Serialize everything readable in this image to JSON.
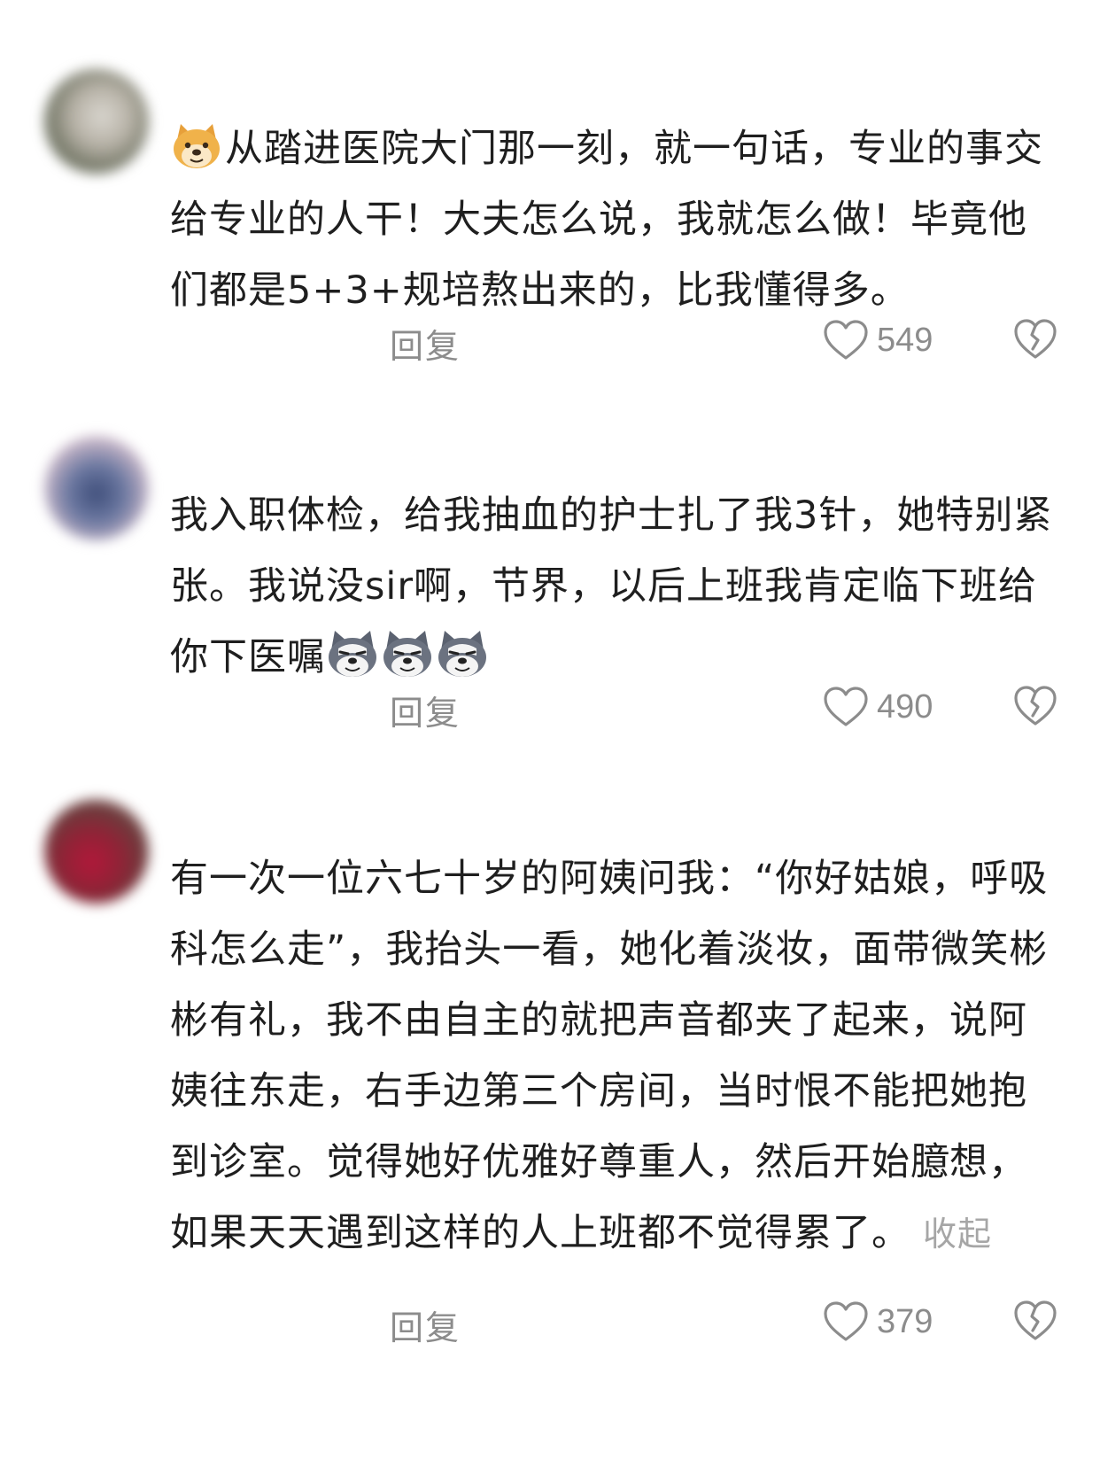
{
  "comments": [
    {
      "text": "从踏进医院大门那一刻，就一句话，专业的事交给专业的人干！大夫怎么说，我就怎么做！毕竟他们都是5+3+规培熬出来的，比我懂得多。",
      "leading_emoji": "doge-emoji",
      "trailing_emoji": null,
      "reply_label": "回复",
      "likes": "549"
    },
    {
      "text": "我入职体检，给我抽血的护士扎了我3针，她特别紧张。我说没sir啊，节界，以后上班我肯定临下班给你下医嘱",
      "leading_emoji": null,
      "trailing_emoji": "husky-emoji x3",
      "reply_label": "回复",
      "likes": "490"
    },
    {
      "text": "有一次一位六七十岁的阿姨问我：“你好姑娘，呼吸科怎么走”，我抬头一看，她化着淡妆，面带微笑彬彬有礼，我不由自主的就把声音都夹了起来，说阿姨往东走，右手边第三个房间，当时恨不能把她抱到诊室。觉得她好优雅好尊重人，然后开始臆想，如果天天遇到这样的人上班都不觉得累了。",
      "collapse_label": "收起",
      "reply_label": "回复",
      "likes": "379"
    }
  ],
  "icons": {
    "like": "heart-outline-icon",
    "dislike": "broken-heart-icon"
  },
  "colors": {
    "text": "#1f1f1f",
    "muted": "#8c8c8c",
    "collapse": "#a6a6a6"
  }
}
